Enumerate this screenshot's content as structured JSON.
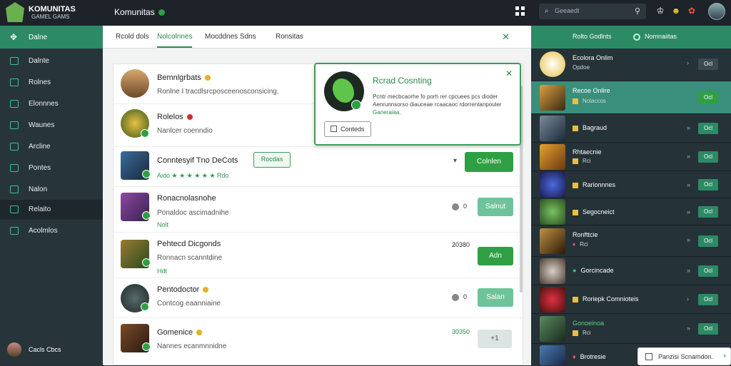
{
  "topbar": {
    "logo_line1": "KOMUNITAS",
    "logo_line2": "GAMEL GAMS",
    "title": "Komunitas",
    "search_placeholder": "Geeaedt"
  },
  "sidebar": {
    "header": "Dalne",
    "items": [
      "Dalnte",
      "Rolnes",
      "Elonnnes",
      "Waunes",
      "Arcline",
      "Pontes",
      "Nalon",
      "Relaito",
      "Acolmlos"
    ],
    "user": "Cacls Cbcs"
  },
  "tabs": {
    "items": [
      "Rcold dols",
      "Nolcolnnes",
      "Mocddnes Sdns",
      "Ronsitas"
    ]
  },
  "popup": {
    "title": "Rcrad Cosnting",
    "desc": "Pcntr mecbcaorhe fo porh rer cpcuees pcs dioder Aenrunnsorso diauceae rcaacaoc rdorrentanpouler",
    "desc_hl": "Ganeraiaa.",
    "button": "Conteds"
  },
  "center": {
    "pinned": [
      {
        "name": "Bemnlgrbats",
        "sub": "Ronlne I tracdlsrcposceenosconsicing."
      },
      {
        "name": "Rolelos",
        "sub": "Nanlcer coenndio"
      }
    ],
    "featured": {
      "name": "Conntesyif Tno DeCots",
      "badge": "Rocdas",
      "stars": "Aido ★ ★ ★ ★ ★ ★ Rdo",
      "button": "Colnlen"
    },
    "list": [
      {
        "name": "Ronacnolasnohe",
        "sub": "Ponaldoc ascimadnihe",
        "tag": "Nolt",
        "count": "0",
        "button": "Salnut"
      },
      {
        "name": "Pehtecd Dicgonds",
        "sub": "Ronnacn scanntdine",
        "tag": "Hdt",
        "count": "20380",
        "button": "Adn"
      },
      {
        "name": "Pentodoctor",
        "sub": "Contcog eaanniaine",
        "tag": "",
        "count": "0",
        "button": "Salan"
      },
      {
        "name": "Gomenice",
        "sub": "Nannes ecanmnnidne",
        "tag": "",
        "count": "30350",
        "button": "+1"
      }
    ]
  },
  "right": {
    "head_a": "Rolto Godlnts",
    "head_b": "Nomnaiitas",
    "rows": [
      {
        "name": "Ecolora Onlim",
        "status": "Opdoe",
        "btn": "Ocl"
      },
      {
        "name": "Recoe Onlire",
        "status": "Nolaccos",
        "btn": "Ocl"
      },
      {
        "name": "Bagraud",
        "status": "",
        "btn": "Ocl"
      },
      {
        "name": "Rhtaecnie",
        "status": "Rci",
        "btn": "Ocl"
      },
      {
        "name": "Rarionnnes",
        "status": "",
        "btn": "Ocl"
      },
      {
        "name": "Segocneict",
        "status": "",
        "btn": "Ocl"
      },
      {
        "name": "Ronfttcie",
        "status": "Rci",
        "btn": "Ocl"
      },
      {
        "name": "Gorcincade",
        "status": "",
        "btn": "Ocl"
      },
      {
        "name": "Roriepk Comnioteis",
        "status": "",
        "btn": "Ocl"
      },
      {
        "name": "Gonoeinoa",
        "status": "Rci",
        "btn": "Ocl"
      },
      {
        "name": "Brotresie",
        "status": "",
        "btn": ""
      }
    ],
    "toast": "Panzisi Scnamdon."
  },
  "colors": {
    "accent": "#2c8a64",
    "success": "#2ea043",
    "sidebar": "#27353b"
  }
}
